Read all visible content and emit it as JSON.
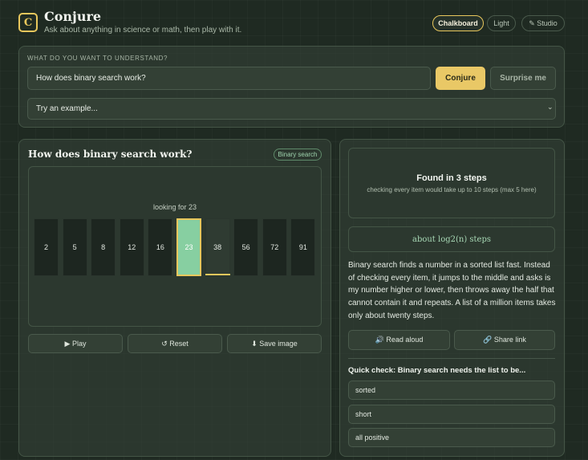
{
  "app": {
    "logo_letter": "C",
    "title": "Conjure",
    "subtitle": "Ask about anything in science or math, then play with it."
  },
  "modes": [
    {
      "label": "Chalkboard",
      "active": true
    },
    {
      "label": "Light",
      "active": false
    },
    {
      "label": "✎ Studio",
      "active": false
    }
  ],
  "ask": {
    "label": "WHAT DO YOU WANT TO UNDERSTAND?",
    "question_value": "How does binary search work?",
    "conjure_label": "Conjure",
    "surprise_label": "Surprise me",
    "example_select": "Try an example..."
  },
  "viz": {
    "title": "How does binary search work?",
    "tag": "Binary search",
    "status": "looking for 23",
    "array": [
      "2",
      "5",
      "8",
      "12",
      "16",
      "23",
      "38",
      "56",
      "72",
      "91"
    ],
    "found_index": 5,
    "pointer_index": 6,
    "play_label": "▶ Play",
    "reset_label": "↺ Reset",
    "save_label": "⬇ Save image"
  },
  "result": {
    "headline": "Found in 3 steps",
    "detail": "checking every item would take up to 10 steps (max 5 here)",
    "formula": "about log2(n) steps",
    "explanation": "Binary search finds a number in a sorted list fast. Instead of checking every item, it jumps to the middle and asks is my number higher or lower, then throws away the half that cannot contain it and repeats. A list of a million items takes only about twenty steps.",
    "read_aloud_label": "🔊 Read aloud",
    "share_label": "🔗 Share link"
  },
  "quiz": {
    "question": "Quick check: Binary search needs the list to be...",
    "options": [
      "sorted",
      "short",
      "all positive"
    ]
  },
  "colors": {
    "accent": "#e8c75c",
    "found_cell": "#87cfa1",
    "background": "#1f2a22"
  }
}
